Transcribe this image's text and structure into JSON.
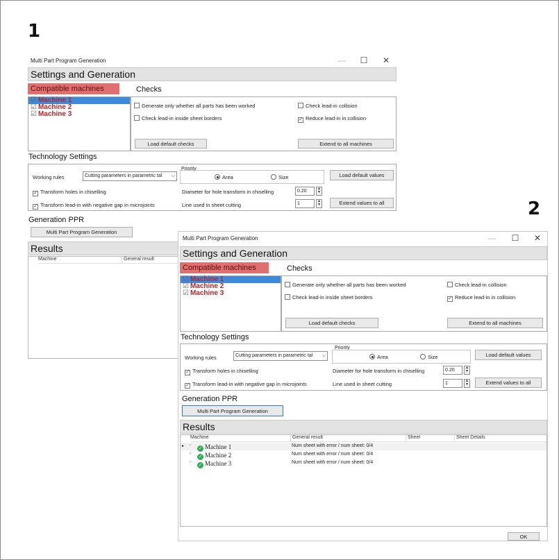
{
  "labels": {
    "step1": "1",
    "step2": "2"
  },
  "window": {
    "title": "Multi Part Program Generation",
    "minimize": "—",
    "maximize": "☐",
    "close": "✕"
  },
  "settings": {
    "header": "Settings and Generation",
    "compatible_machines_label": "Compatible machines",
    "machines": [
      {
        "name": "Machine 1",
        "checked": true,
        "selected": true
      },
      {
        "name": "Machine 2",
        "checked": true,
        "selected": false
      },
      {
        "name": "Machine 3",
        "checked": true,
        "selected": false
      }
    ],
    "checks_label": "Checks",
    "checks": {
      "generate_only": {
        "label": "Generate only whether all parts has been worked",
        "checked": false
      },
      "check_leadin_borders": {
        "label": "Check lead-in inside sheet borders",
        "checked": false
      },
      "check_leadin_collision": {
        "label": "Check lead-in collision",
        "checked": false
      },
      "reduce_leadin_collision": {
        "label": "Reduce lead-in in collision",
        "checked": true
      }
    },
    "load_default_checks": "Load default checks",
    "extend_to_all_machines": "Extend to all machines"
  },
  "technology": {
    "header": "Technology Settings",
    "working_rules_label": "Working rules",
    "working_rules_value": "Cutting parameters in parametric tal",
    "priority_label": "Priority",
    "priority_area": "Area",
    "priority_size": "Size",
    "priority_selected": "Area",
    "load_default_values": "Load default values",
    "transform_holes": {
      "label": "Transform holes in chiselling",
      "checked": true
    },
    "transform_leadin": {
      "label": "Transform lead-in with negative gap in microjoints",
      "checked": true
    },
    "diameter_label": "Diameter for hole transform in chiselling",
    "diameter_value": "0.20",
    "line_used_label": "Line used in sheet cutting",
    "line_used_value": "1",
    "extend_values_to_all": "Extend values to all"
  },
  "generation": {
    "header": "Generation PPR",
    "button": "Multi Part Program Generation"
  },
  "results": {
    "header": "Results",
    "columns": [
      "Machine",
      "General result",
      "Sheet",
      "Sheet Details"
    ],
    "rows": [
      {
        "machine": "Machine 1",
        "general_result": "Num sheet with error / num sheet: 0/4",
        "sheet": "",
        "details": ""
      },
      {
        "machine": "Machine 2",
        "general_result": "Num sheet with error / num sheet: 0/4",
        "sheet": "",
        "details": ""
      },
      {
        "machine": "Machine 3",
        "general_result": "Num sheet with error / num sheet: 0/4",
        "sheet": "",
        "details": ""
      }
    ],
    "ok_button": "OK"
  },
  "colors": {
    "compatible_highlight": "#e07070",
    "machine_text": "#b3252b",
    "selection_blue": "#3e8ad8",
    "status_ok": "#2eae52"
  },
  "icons": {
    "status": "check-circle-icon",
    "expand": "expand-arrow-icon",
    "row_pointer": "row-pointer-icon"
  }
}
